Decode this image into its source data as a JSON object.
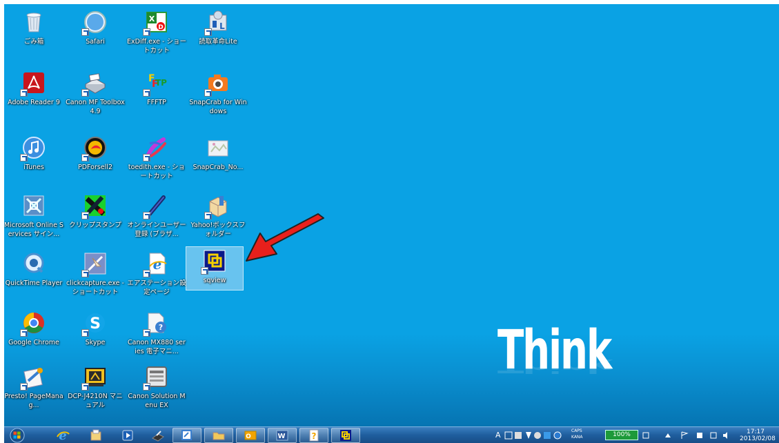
{
  "desktop": {
    "brand_text": "Think",
    "icons": [
      {
        "label": "ごみ箱"
      },
      {
        "label": "Safari"
      },
      {
        "label": "ExDiff.exe - ショートカット"
      },
      {
        "label": "読取革命Lite"
      },
      {
        "label": "Adobe Reader 9"
      },
      {
        "label": "Canon MF Toolbox 4.9"
      },
      {
        "label": "FFFTP"
      },
      {
        "label": "SnapCrab for Windows"
      },
      {
        "label": "iTunes"
      },
      {
        "label": "PDForsell2"
      },
      {
        "label": "toedith.exe - ショートカット"
      },
      {
        "label": "SnapCrab_No..."
      },
      {
        "label": "Microsoft Online Services サイン..."
      },
      {
        "label": "クリップスタンプ"
      },
      {
        "label": "オンラインユーザー登録 (ブラザ..."
      },
      {
        "label": "Yahoo!ボックスフォルダー"
      },
      {
        "label": "QuickTime Player"
      },
      {
        "label": "clickcapture.exe - ショートカット"
      },
      {
        "label": "エアステーション設定ページ"
      },
      {
        "label": "sqview"
      },
      {
        "label": "Google Chrome"
      },
      {
        "label": "Skype"
      },
      {
        "label": "Canon MX880 series 電子マニ..."
      },
      {
        "label": "Presto! PageManag..."
      },
      {
        "label": "DCP-J4210N マニュアル"
      },
      {
        "label": "Canon Solution Menu EX"
      }
    ]
  },
  "taskbar": {
    "buttons": [
      {
        "icon": "internet-explorer-icon"
      },
      {
        "icon": "file-explorer-icon"
      },
      {
        "icon": "media-player-icon"
      },
      {
        "icon": "scanner-icon"
      },
      {
        "icon": "snipping-icon"
      },
      {
        "icon": "folder-icon"
      },
      {
        "icon": "outlook-icon"
      },
      {
        "icon": "word-icon"
      },
      {
        "icon": "help-icon"
      },
      {
        "icon": "sqview-icon"
      }
    ],
    "tray": {
      "ime_text": "A",
      "caps_text": "CAPS",
      "kana_text": "KANA",
      "battery": "100%",
      "time": "17:17",
      "date": "2013/02/08"
    }
  },
  "colors": {
    "desktop": "#0aa2e4",
    "arrow": "#e8201c",
    "taskbar": "#1f5e9e"
  }
}
